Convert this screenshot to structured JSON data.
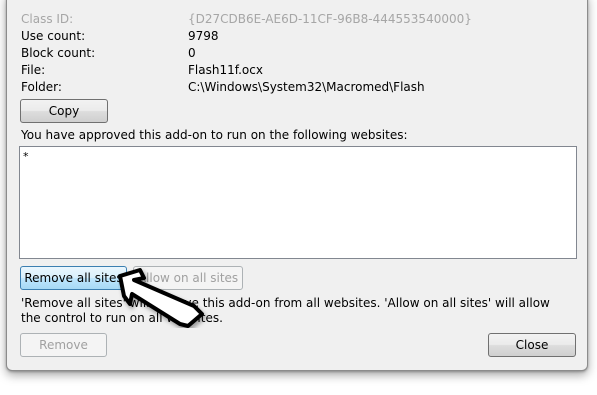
{
  "info": {
    "class_id_label": "Class ID:",
    "class_id_value": "{D27CDB6E-AE6D-11CF-96B8-444553540000}",
    "use_count_label": "Use count:",
    "use_count_value": "9798",
    "block_count_label": "Block count:",
    "block_count_value": "0",
    "file_label": "File:",
    "file_value": "Flash11f.ocx",
    "folder_label": "Folder:",
    "folder_value": "C:\\Windows\\System32\\Macromed\\Flash"
  },
  "copy_button": "Copy",
  "sites_label": "You have approved this add-on to run on the following websites:",
  "sites": [
    "*"
  ],
  "remove_all_button": "Remove all sites",
  "allow_all_button": "Allow on all sites",
  "help_text": "'Remove all sites' will remove this add-on from all websites. 'Allow on all sites' will allow the control to run on all websites.",
  "remove_button": "Remove",
  "close_button": "Close",
  "cursor_icon": "hand-pointer-arrow-icon"
}
